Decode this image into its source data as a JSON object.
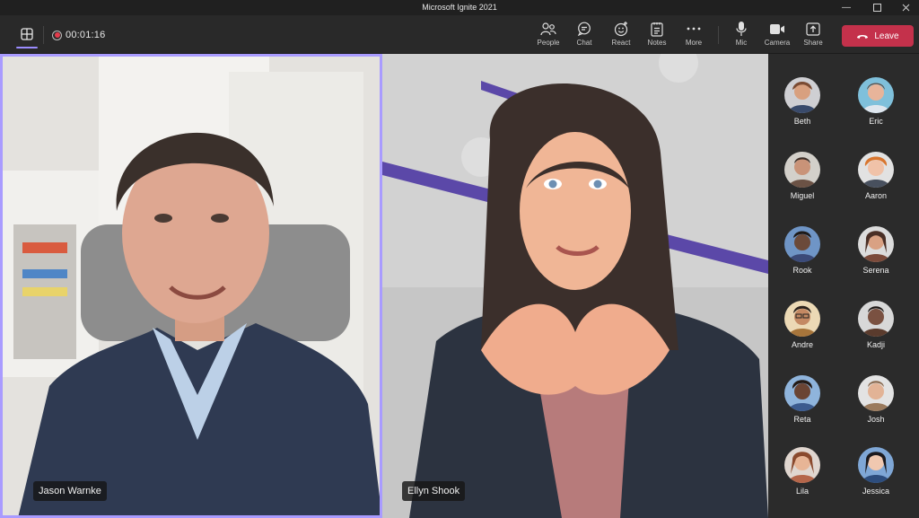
{
  "window": {
    "title": "Microsoft Ignite 2021"
  },
  "toolbar": {
    "recording_time": "00:01:16",
    "tools": [
      {
        "label": "People",
        "icon": "people-icon"
      },
      {
        "label": "Chat",
        "icon": "chat-icon"
      },
      {
        "label": "React",
        "icon": "react-icon"
      },
      {
        "label": "Notes",
        "icon": "notes-icon"
      },
      {
        "label": "More",
        "icon": "more-icon"
      },
      {
        "label": "Mic",
        "icon": "mic-icon"
      },
      {
        "label": "Camera",
        "icon": "camera-icon"
      },
      {
        "label": "Share",
        "icon": "share-icon"
      }
    ],
    "leave_label": "Leave"
  },
  "stage": {
    "tiles": [
      {
        "name": "Jason Warnke",
        "active_speaker": true
      },
      {
        "name": "Ellyn Shook",
        "active_speaker": false
      }
    ]
  },
  "roster": [
    {
      "name": "Beth",
      "color": "#7a4b33"
    },
    {
      "name": "Eric",
      "color": "#5fa7c9"
    },
    {
      "name": "Miguel",
      "color": "#6b5245"
    },
    {
      "name": "Aaron",
      "color": "#d9762e"
    },
    {
      "name": "Rook",
      "color": "#3b4a78"
    },
    {
      "name": "Serena",
      "color": "#7b4a3a"
    },
    {
      "name": "Andre",
      "color": "#a7753b"
    },
    {
      "name": "Kadji",
      "color": "#5a3b2d"
    },
    {
      "name": "Reta",
      "color": "#3c5b8f"
    },
    {
      "name": "Josh",
      "color": "#9a7a5d"
    },
    {
      "name": "Lila",
      "color": "#b5664a"
    },
    {
      "name": "Jessica",
      "color": "#2d4d7d"
    }
  ],
  "colors": {
    "accent": "#a99bff",
    "leave": "#c4314b",
    "recording": "#e33b4c"
  }
}
